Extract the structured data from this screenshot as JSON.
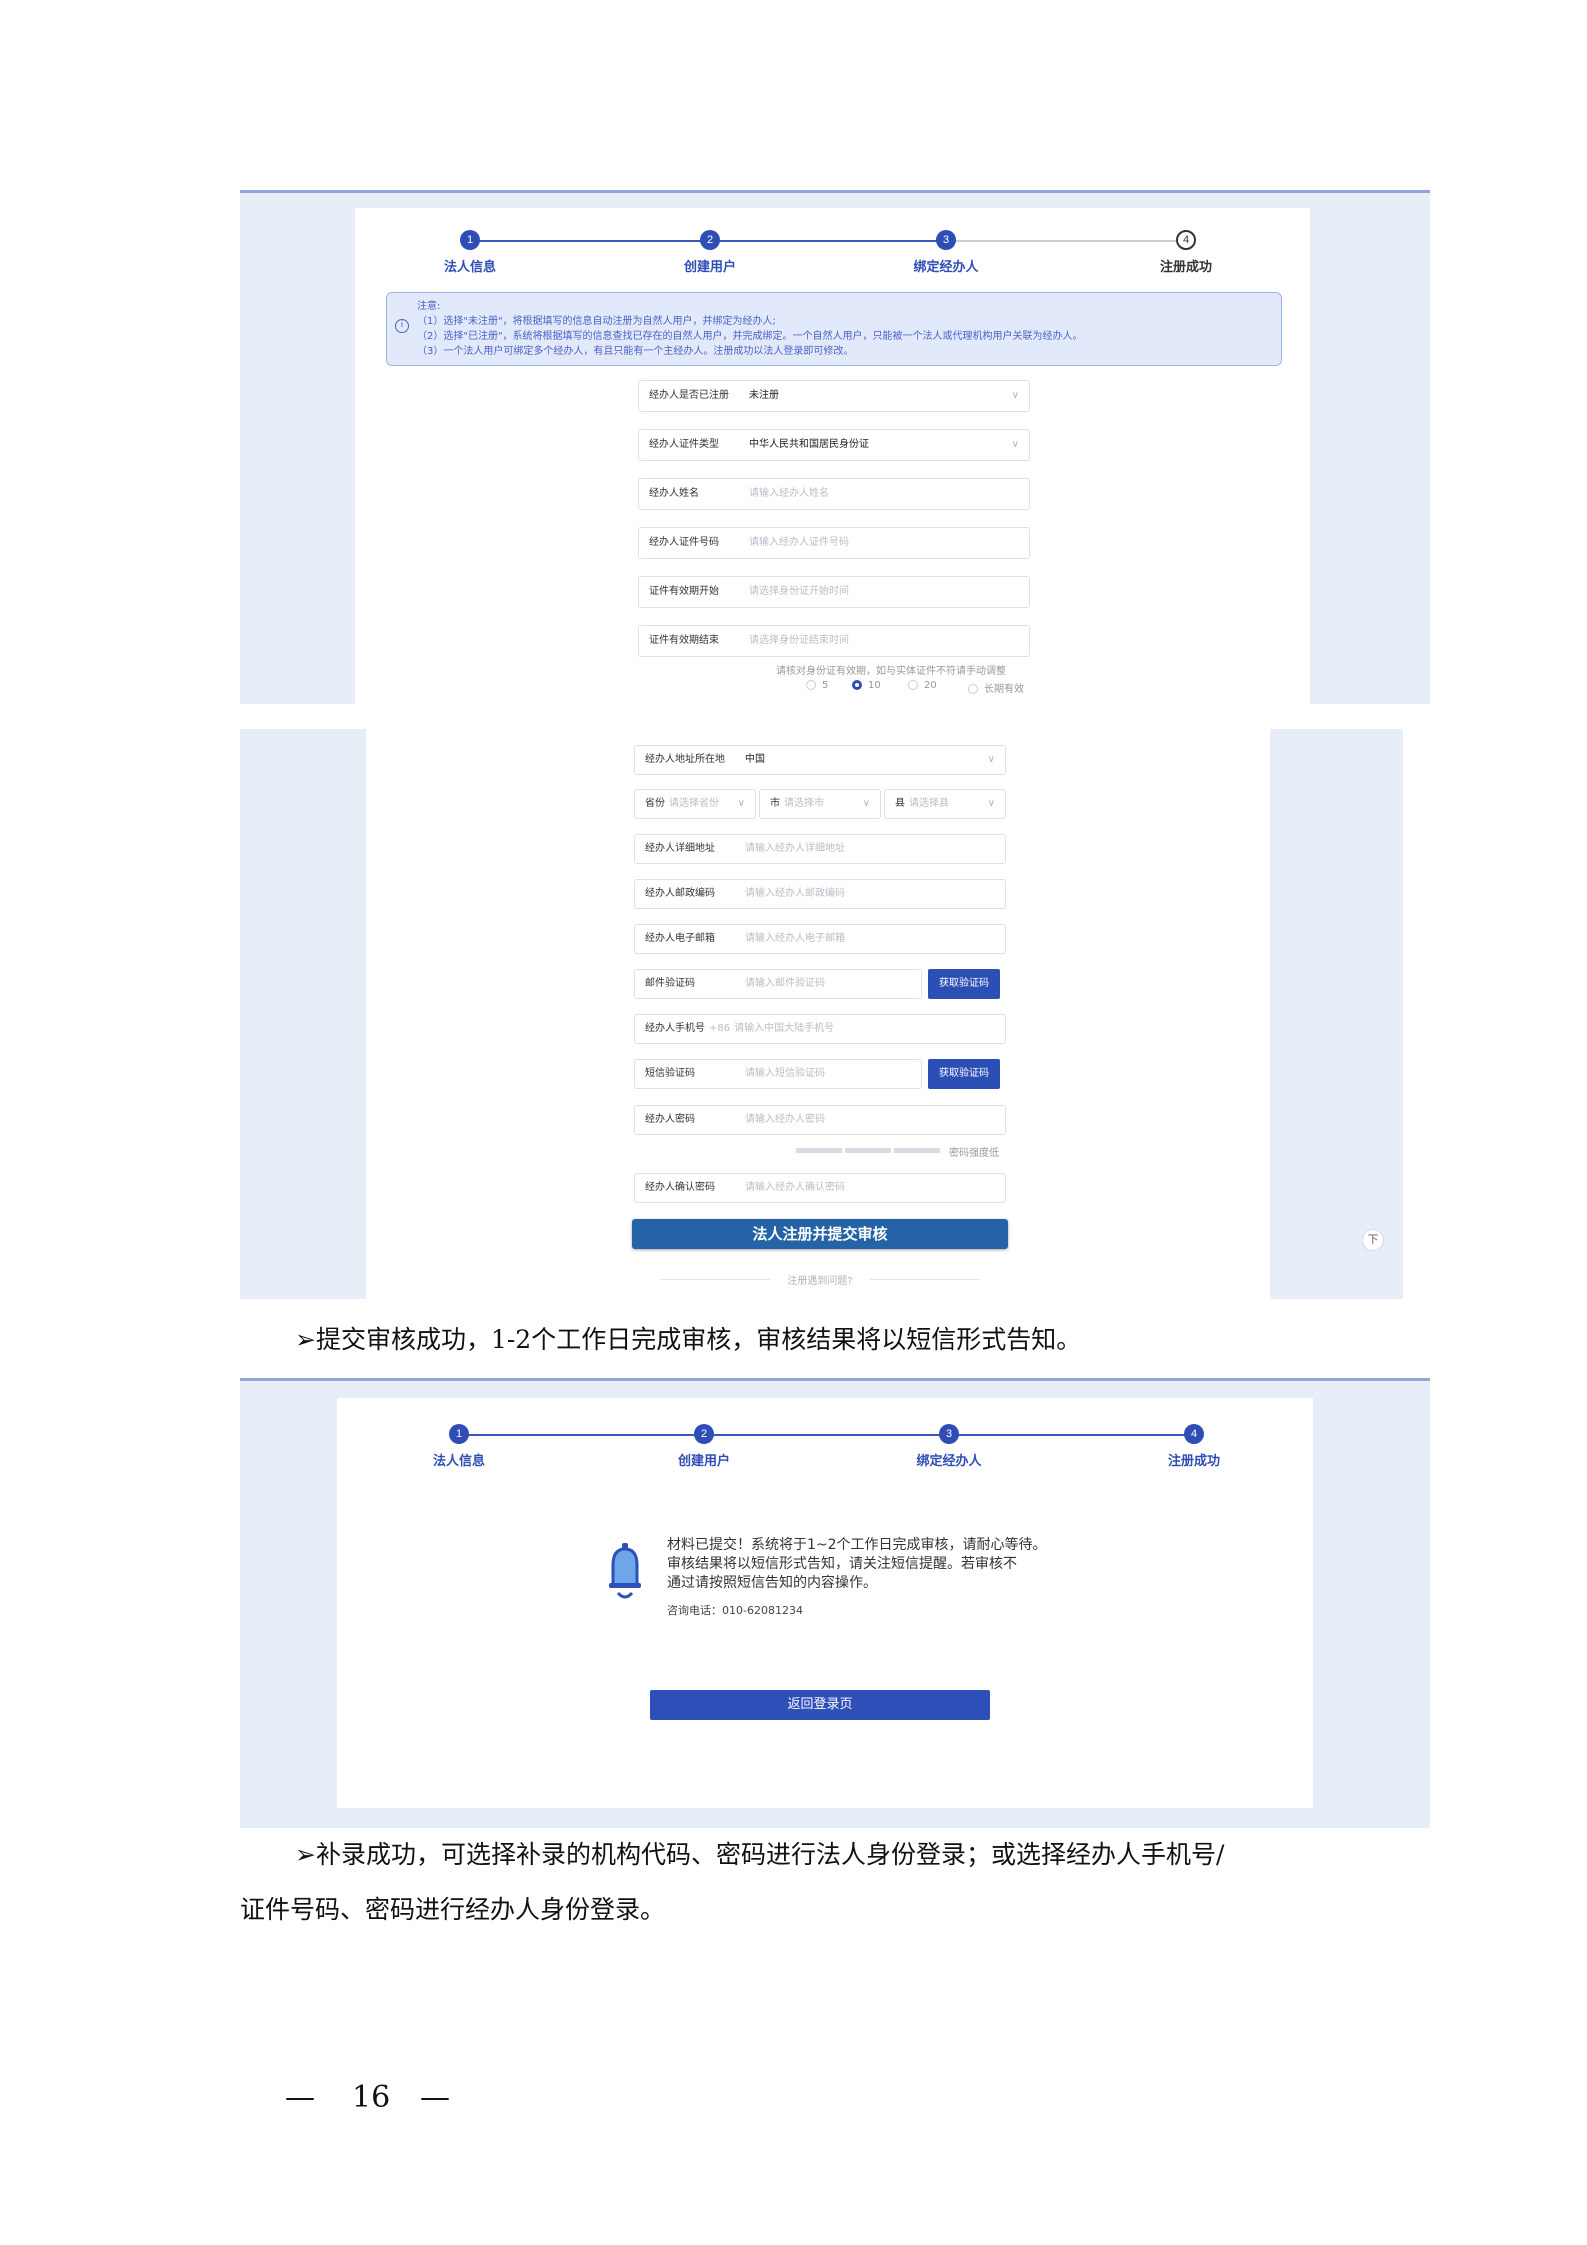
{
  "stepper": {
    "steps": [
      "法人信息",
      "创建用户",
      "绑定经办人",
      "注册成功"
    ],
    "numbers": [
      "1",
      "2",
      "3",
      "4"
    ]
  },
  "notice": {
    "icon": "info-icon",
    "title": "注意:",
    "lines": [
      "（1）选择\"未注册\"，将根据填写的信息自动注册为自然人用户，并绑定为经办人;",
      "（2）选择\"已注册\"，系统将根据填写的信息查找已存在的自然人用户，并完成绑定。一个自然人用户，只能被一个法人或代理机构用户关联为经办人。",
      "（3）一个法人用户可绑定多个经办人，有且只能有一个主经办人。注册成功以法人登录即可修改。"
    ]
  },
  "form1": [
    {
      "label": "经办人是否已注册",
      "value": "未注册",
      "placeholder": "",
      "select": true
    },
    {
      "label": "经办人证件类型",
      "value": "中华人民共和国居民身份证",
      "placeholder": "",
      "select": true
    },
    {
      "label": "经办人姓名",
      "value": "",
      "placeholder": "请输入经办人姓名",
      "select": false
    },
    {
      "label": "经办人证件号码",
      "value": "",
      "placeholder": "请输入经办人证件号码",
      "select": false
    },
    {
      "label": "证件有效期开始",
      "value": "",
      "placeholder": "请选择身份证开始时间",
      "select": false
    },
    {
      "label": "证件有效期结束",
      "value": "",
      "placeholder": "请选择身份证结束时间",
      "select": false
    }
  ],
  "validity_note": "请核对身份证有效期，如与实体证件不符请手动调整",
  "validity_options": [
    "5",
    "10",
    "20",
    "长期有效"
  ],
  "validity_selected": "10",
  "form2": {
    "address_region": {
      "label": "经办人地址所在地",
      "value": "中国"
    },
    "province": {
      "label": "省份",
      "placeholder": "请选择省份"
    },
    "city": {
      "label": "市",
      "placeholder": "请选择市"
    },
    "county": {
      "label": "县",
      "placeholder": "请选择县"
    },
    "detail_address": {
      "label": "经办人详细地址",
      "placeholder": "请输入经办人详细地址"
    },
    "postcode": {
      "label": "经办人邮政编码",
      "placeholder": "请输入经办人邮政编码"
    },
    "email": {
      "label": "经办人电子邮箱",
      "placeholder": "请输入经办人电子邮箱"
    },
    "email_code": {
      "label": "邮件验证码",
      "placeholder": "请输入邮件验证码",
      "button": "获取验证码"
    },
    "mobile": {
      "label": "经办人手机号",
      "prefix": "+86",
      "placeholder": "请输入中国大陆手机号"
    },
    "sms_code": {
      "label": "短信验证码",
      "placeholder": "请输入短信验证码",
      "button": "获取验证码"
    },
    "password": {
      "label": "经办人密码",
      "placeholder": "请输入经办人密码"
    },
    "strength": "密码强度低",
    "confirm": {
      "label": "经办人确认密码",
      "placeholder": "请输入经办人确认密码"
    },
    "submit": "法人注册并提交审核",
    "help": "注册遇到问题?",
    "scroll_icon": "下"
  },
  "para1": "➢提交审核成功，1-2个工作日完成审核，审核结果将以短信形式告知。",
  "success": {
    "icon": "bell-icon",
    "lines": [
      "材料已提交！系统将于1~2个工作日完成审核，请耐心等待。",
      "审核结果将以短信形式告知，请关注短信提醒。若审核不",
      "通过请按照短信告知的内容操作。"
    ],
    "phone": "咨询电话：010-62081234",
    "return_button": "返回登录页"
  },
  "para2_line1": "➢补录成功，可选择补录的机构代码、密码进行法人身份登录；或选择经办人手机号/",
  "para2_line2": "证件号码、密码进行经办人身份登录。",
  "page_number": "16",
  "page_dash": "—"
}
